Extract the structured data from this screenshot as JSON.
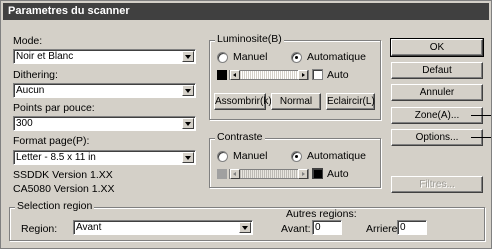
{
  "window": {
    "title": "Parametres du scanner"
  },
  "left": {
    "mode": {
      "label": "Mode:",
      "value": "Noir et Blanc"
    },
    "dithering": {
      "label": "Dithering:",
      "value": "Aucun"
    },
    "ppp": {
      "label": "Points par pouce:",
      "value": "300"
    },
    "format": {
      "label": "Format page(P):",
      "value": "Letter - 8.5 x 11 in"
    },
    "versions": [
      "SSDDK Version 1.XX",
      "CA5080 Version 1.XX"
    ]
  },
  "luminosite": {
    "title": "Luminosite(B)",
    "manuel": "Manuel",
    "auto": "Automatique",
    "auto_check": "Auto",
    "selected": "auto",
    "buttons": [
      "Assombrir(k)",
      "Normal",
      "Eclaircir(L)"
    ]
  },
  "contraste": {
    "title": "Contraste",
    "manuel": "Manuel",
    "auto": "Automatique",
    "auto_check": "Auto",
    "selected": "auto"
  },
  "right_buttons": {
    "ok": "OK",
    "defaut": "Defaut",
    "annuler": "Annuler",
    "zone": "Zone(A)...",
    "options": "Options...",
    "filtres": "Filtres..."
  },
  "selection": {
    "title": "Selection region",
    "region_label": "Region:",
    "region_value": "Avant",
    "autres": "Autres regions:",
    "avant_label": "Avant:",
    "avant_value": "0",
    "arriere_label": "Arriere:",
    "arriere_value": "0"
  },
  "colors": {
    "titlebar": "#404040",
    "face": "#d4d0c8"
  }
}
